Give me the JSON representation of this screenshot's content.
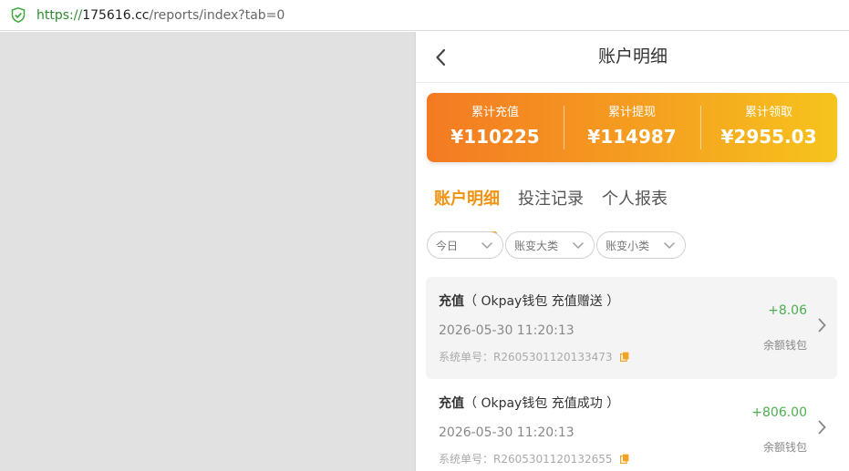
{
  "browser": {
    "url_scheme": "https://",
    "url_host": "175616.cc",
    "url_path": "/reports/index?tab=0",
    "icon": "shield-check-icon"
  },
  "header": {
    "title": "账户明细",
    "back_icon": "chevron-left-icon"
  },
  "summary": {
    "stats": [
      {
        "label": "累计充值",
        "value": "¥110225"
      },
      {
        "label": "累计提现",
        "value": "¥114987"
      },
      {
        "label": "累计领取",
        "value": "¥2955.03"
      }
    ],
    "gradient_start": "#f47a22",
    "gradient_end": "#f6c41c"
  },
  "tabs": [
    {
      "label": "账户明细",
      "active": true
    },
    {
      "label": "投注记录",
      "active": false
    },
    {
      "label": "个人报表",
      "active": false
    }
  ],
  "filters": [
    {
      "label": "今日"
    },
    {
      "label": "账变大类"
    },
    {
      "label": "账变小类"
    }
  ],
  "records": [
    {
      "type": "充值",
      "detail": "（ Okpay钱包 充值赠送 ）",
      "time": "2026-05-30 11:20:13",
      "order": "系统单号：R2605301120133473",
      "amount": "+8.06",
      "wallet": "余额钱包"
    },
    {
      "type": "充值",
      "detail": "（ Okpay钱包 充值成功 ）",
      "time": "2026-05-30 11:20:13",
      "order": "系统单号：R2605301120132655",
      "amount": "+806.00",
      "wallet": "余额钱包"
    }
  ],
  "colors": {
    "accent": "#f39211",
    "positive": "#4caf50"
  }
}
